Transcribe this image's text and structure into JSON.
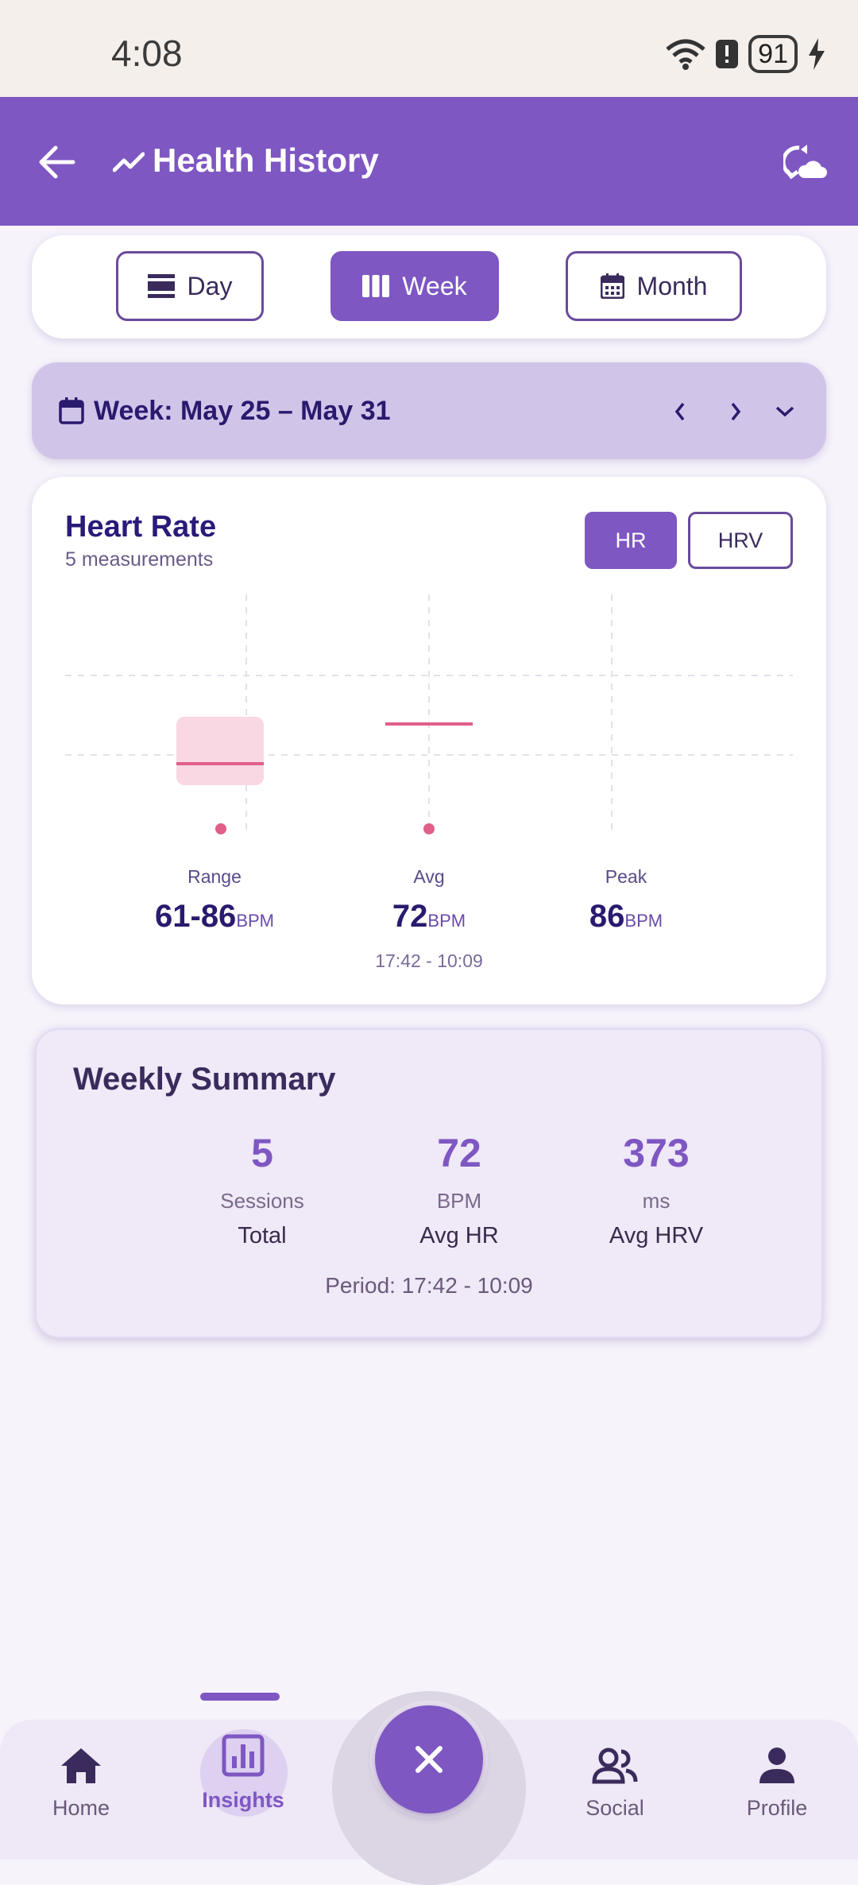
{
  "status": {
    "time": "4:08",
    "battery": "91"
  },
  "appbar": {
    "title": "Health History"
  },
  "periods": {
    "day": "Day",
    "week": "Week",
    "month": "Month",
    "selected": "week"
  },
  "week_nav": {
    "label": "Week: May 25 – May 31"
  },
  "heart_rate": {
    "title": "Heart Rate",
    "subtitle": "5 measurements",
    "toggle_hr": "HR",
    "toggle_hrv": "HRV",
    "stats": {
      "range_label": "Range",
      "range_value": "61-86",
      "range_unit": "BPM",
      "avg_label": "Avg",
      "avg_value": "72",
      "avg_unit": "BPM",
      "avg_time": "17:42 - 10:09",
      "peak_label": "Peak",
      "peak_value": "86",
      "peak_unit": "BPM"
    }
  },
  "summary": {
    "title": "Weekly Summary",
    "sessions": {
      "value": "5",
      "unit": "Sessions",
      "label": "Total"
    },
    "bpm": {
      "value": "72",
      "unit": "BPM",
      "label": "Avg HR"
    },
    "hrv": {
      "value": "373",
      "unit": "ms",
      "label": "Avg HRV"
    },
    "period": "Period: 17:42 - 10:09"
  },
  "nav": {
    "home": "Home",
    "insights": "Insights",
    "social": "Social",
    "profile": "Profile",
    "active": "insights"
  },
  "colors": {
    "primary": "#7e57c2",
    "accent_pink": "#e0608a",
    "week_bar": "#d1c4e9"
  }
}
